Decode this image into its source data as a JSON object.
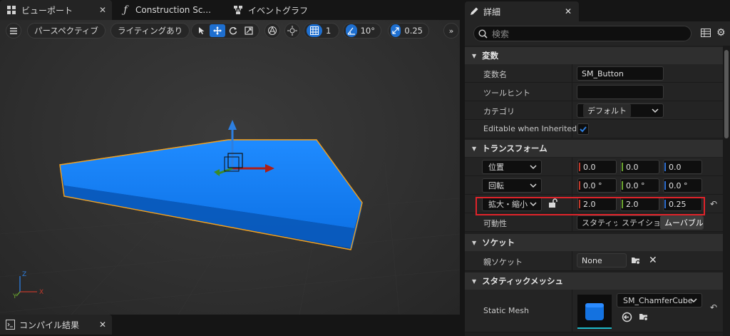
{
  "tabs": [
    {
      "label": "ビューポート",
      "icon": "grid-icon"
    },
    {
      "label": "Construction Sc...",
      "icon": "function-icon"
    },
    {
      "label": "イベントグラフ",
      "icon": "graph-icon"
    }
  ],
  "viewport_toolbar": {
    "perspective_label": "パースペクティブ",
    "lighting_label": "ライティングあり",
    "grid_snap_value": "1",
    "rotation_snap_value": "10°",
    "scale_snap_value": "0.25"
  },
  "bottom_tab": {
    "label": "コンパイル結果"
  },
  "details": {
    "tab_label": "詳細",
    "search_placeholder": "検索",
    "sections": {
      "variable": "変数",
      "transform": "トランスフォーム",
      "socket": "ソケット",
      "static_mesh": "スタティックメッシュ"
    },
    "variable": {
      "name_label": "変数名",
      "name_value": "SM_Button",
      "tooltip_label": "ツールヒント",
      "tooltip_value": "",
      "category_label": "カテゴリ",
      "category_value": "デフォルト",
      "editable_label": "Editable when Inherited",
      "editable_checked": true
    },
    "transform": {
      "location_label": "位置",
      "location": [
        "0.0",
        "0.0",
        "0.0"
      ],
      "rotation_label": "回転",
      "rotation": [
        "0.0 °",
        "0.0 °",
        "0.0 °"
      ],
      "scale_label": "拡大・縮小",
      "scale": [
        "2.0",
        "2.0",
        "0.25"
      ],
      "mobility_label": "可動性",
      "mobility_options": [
        "スタティック",
        "ステイショナリー",
        "ムーバブル"
      ],
      "mobility_selected": "ムーバブル"
    },
    "socket": {
      "parent_label": "親ソケット",
      "parent_value": "None"
    },
    "static_mesh": {
      "label": "Static Mesh",
      "value": "SM_ChamferCube"
    }
  },
  "colors": {
    "accent": "#1e6fd0",
    "mesh": "#1170e0",
    "selection_outline": "#f0a020",
    "highlight_box": "#e0232a"
  }
}
